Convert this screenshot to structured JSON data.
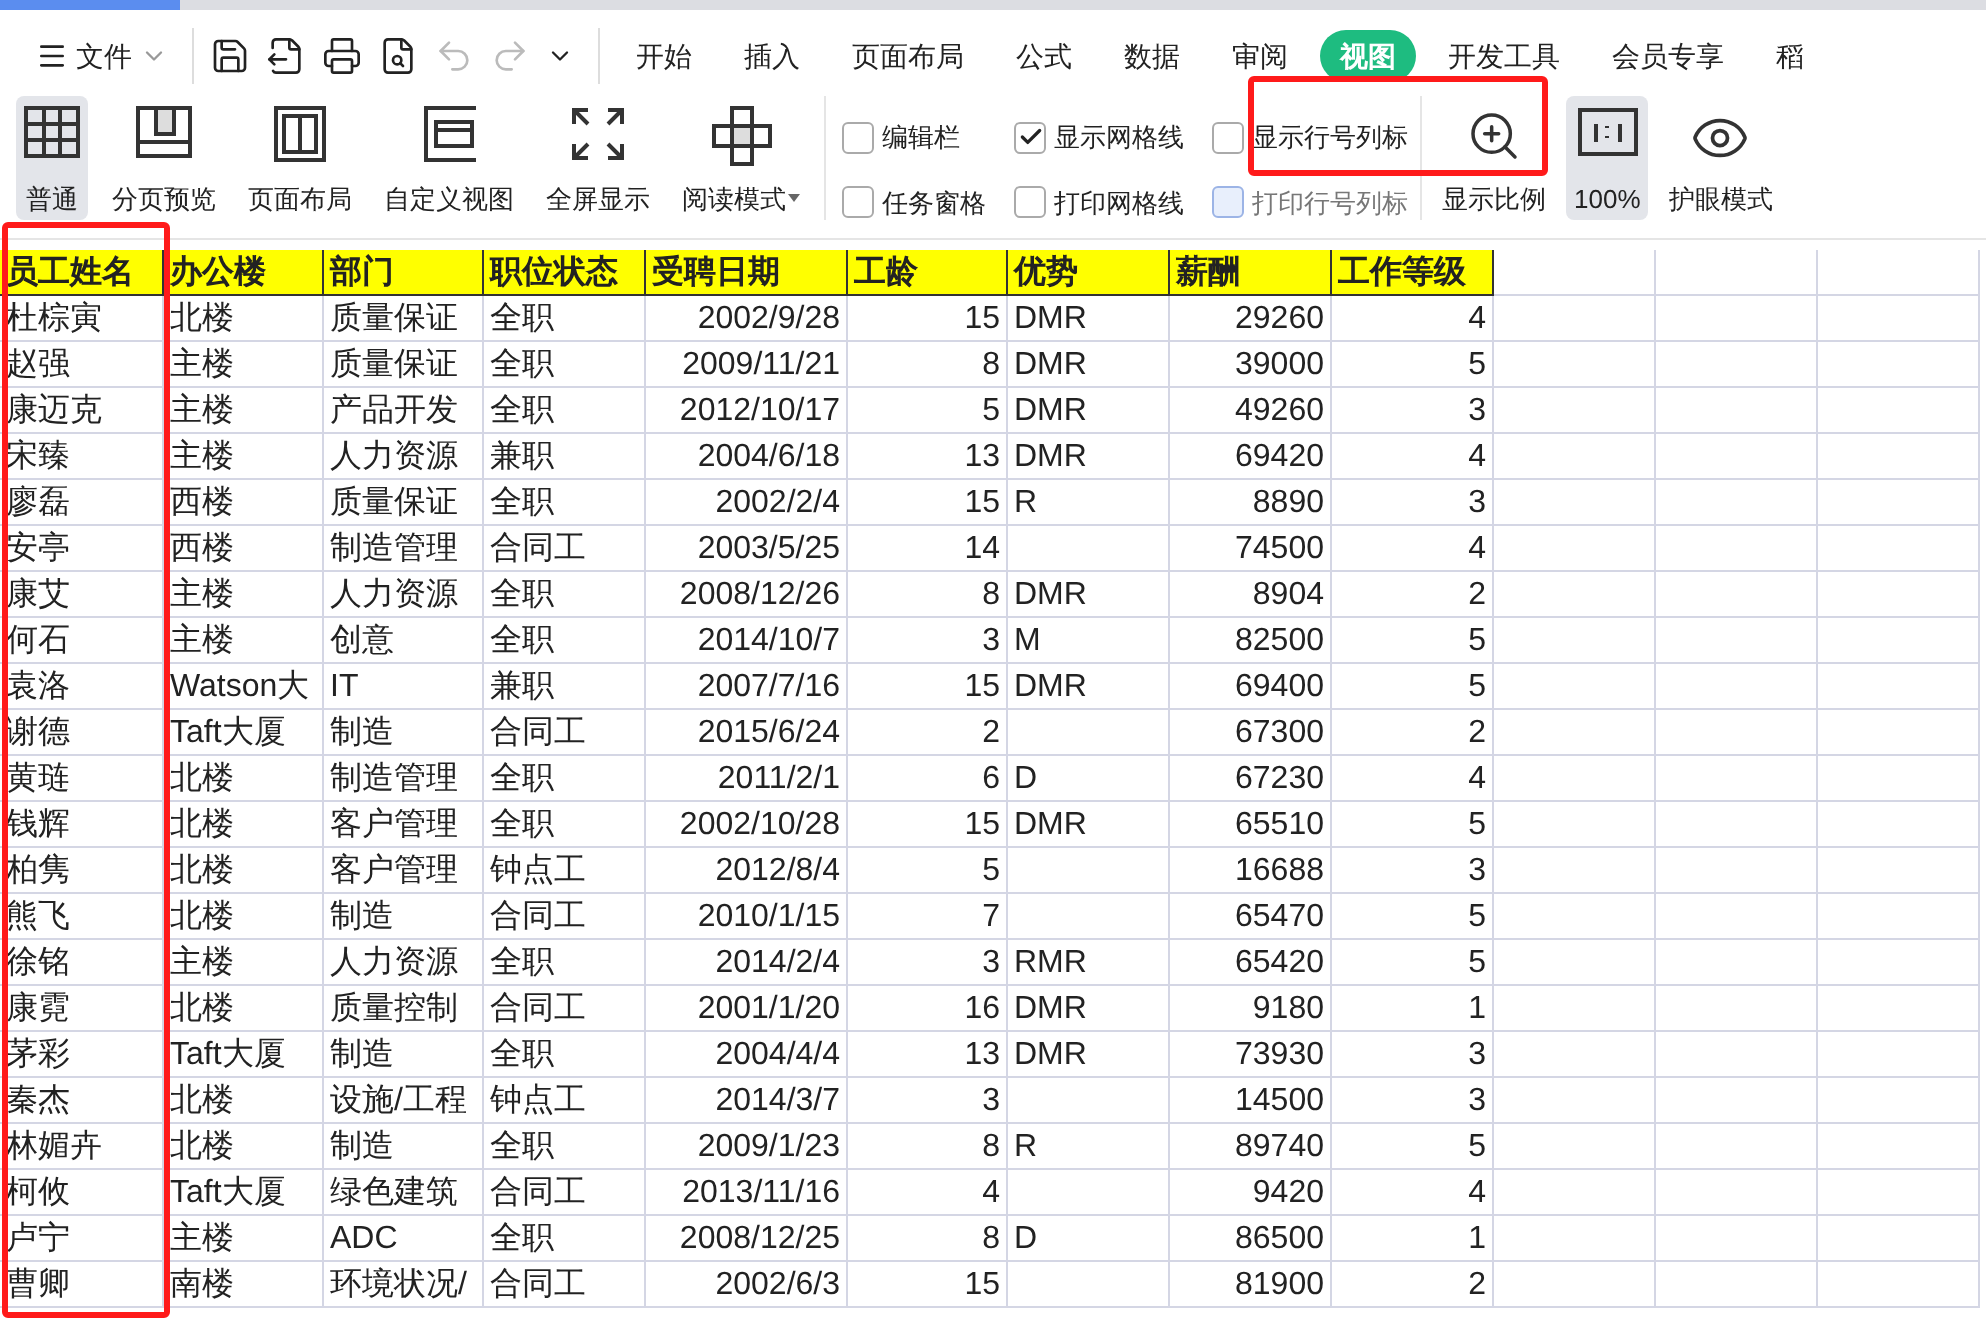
{
  "file_menu": {
    "label": "文件"
  },
  "menu_tabs": [
    {
      "label": "开始",
      "selected": false
    },
    {
      "label": "插入",
      "selected": false
    },
    {
      "label": "页面布局",
      "selected": false
    },
    {
      "label": "公式",
      "selected": false
    },
    {
      "label": "数据",
      "selected": false
    },
    {
      "label": "审阅",
      "selected": false
    },
    {
      "label": "视图",
      "selected": true
    },
    {
      "label": "开发工具",
      "selected": false
    },
    {
      "label": "会员专享",
      "selected": false
    },
    {
      "label": "稻",
      "selected": false
    }
  ],
  "view_buttons": [
    {
      "label": "普通",
      "kind": "normal",
      "selected": true
    },
    {
      "label": "分页预览",
      "kind": "pagebreak",
      "selected": false
    },
    {
      "label": "页面布局",
      "kind": "layout",
      "selected": false
    },
    {
      "label": "自定义视图",
      "kind": "custom",
      "selected": false
    },
    {
      "label": "全屏显示",
      "kind": "fullscreen",
      "selected": false
    },
    {
      "label": "阅读模式",
      "kind": "reading",
      "selected": false
    }
  ],
  "options": [
    {
      "label": "编辑栏",
      "checked": false,
      "disabled": false
    },
    {
      "label": "任务窗格",
      "checked": false,
      "disabled": false
    },
    {
      "label": "显示网格线",
      "checked": true,
      "disabled": false
    },
    {
      "label": "打印网格线",
      "checked": false,
      "disabled": false
    },
    {
      "label": "显示行号列标",
      "checked": false,
      "disabled": false
    },
    {
      "label": "打印行号列标",
      "checked": false,
      "disabled": true
    }
  ],
  "zoom_buttons": [
    {
      "label": "显示比例",
      "kind": "zoom",
      "selected": false
    },
    {
      "label": "100%",
      "kind": "actual",
      "selected": true
    },
    {
      "label": "护眼模式",
      "kind": "eye",
      "selected": false
    }
  ],
  "table": {
    "columns": [
      "员工姓名",
      "办公楼",
      "部门",
      "职位状态",
      "受聘日期",
      "工龄",
      "优势",
      "薪酬",
      "工作等级"
    ],
    "rows": [
      [
        "杜棕寅",
        "北楼",
        "质量保证",
        "全职",
        "2002/9/28",
        "15",
        "DMR",
        "29260",
        "4"
      ],
      [
        "赵强",
        "主楼",
        "质量保证",
        "全职",
        "2009/11/21",
        "8",
        "DMR",
        "39000",
        "5"
      ],
      [
        "康迈克",
        "主楼",
        "产品开发",
        "全职",
        "2012/10/17",
        "5",
        "DMR",
        "49260",
        "3"
      ],
      [
        "宋臻",
        "主楼",
        "人力资源",
        "兼职",
        "2004/6/18",
        "13",
        "DMR",
        "69420",
        "4"
      ],
      [
        "廖磊",
        "西楼",
        "质量保证",
        "全职",
        "2002/2/4",
        "15",
        "R",
        "8890",
        "3"
      ],
      [
        "安亭",
        "西楼",
        "制造管理",
        "合同工",
        "2003/5/25",
        "14",
        "",
        "74500",
        "4"
      ],
      [
        "康艾",
        "主楼",
        "人力资源",
        "全职",
        "2008/12/26",
        "8",
        "DMR",
        "8904",
        "2"
      ],
      [
        "何石",
        "主楼",
        "创意",
        "全职",
        "2014/10/7",
        "3",
        "M",
        "82500",
        "5"
      ],
      [
        "袁洛",
        "Watson大",
        "IT",
        "兼职",
        "2007/7/16",
        "15",
        "DMR",
        "69400",
        "5"
      ],
      [
        "谢德",
        "Taft大厦",
        "制造",
        "合同工",
        "2015/6/24",
        "2",
        "",
        "67300",
        "2"
      ],
      [
        "黄琏",
        "北楼",
        "制造管理",
        "全职",
        "2011/2/1",
        "6",
        "D",
        "67230",
        "4"
      ],
      [
        "钱辉",
        "北楼",
        "客户管理",
        "全职",
        "2002/10/28",
        "15",
        "DMR",
        "65510",
        "5"
      ],
      [
        "柏隽",
        "北楼",
        "客户管理",
        "钟点工",
        "2012/8/4",
        "5",
        "",
        "16688",
        "3"
      ],
      [
        "熊飞",
        "北楼",
        "制造",
        "合同工",
        "2010/1/15",
        "7",
        "",
        "65470",
        "5"
      ],
      [
        "徐铭",
        "主楼",
        "人力资源",
        "全职",
        "2014/2/4",
        "3",
        "RMR",
        "65420",
        "5"
      ],
      [
        "康霓",
        "北楼",
        "质量控制",
        "合同工",
        "2001/1/20",
        "16",
        "DMR",
        "9180",
        "1"
      ],
      [
        "茅彩",
        "Taft大厦",
        "制造",
        "全职",
        "2004/4/4",
        "13",
        "DMR",
        "73930",
        "3"
      ],
      [
        "秦杰",
        "北楼",
        "设施/工程",
        "钟点工",
        "2014/3/7",
        "3",
        "",
        "14500",
        "3"
      ],
      [
        "林媚卉",
        "北楼",
        "制造",
        "全职",
        "2009/1/23",
        "8",
        "R",
        "89740",
        "5"
      ],
      [
        "柯攸",
        "Taft大厦",
        "绿色建筑",
        "合同工",
        "2013/11/16",
        "4",
        "",
        "9420",
        "4"
      ],
      [
        "卢宁",
        "主楼",
        "ADC",
        "全职",
        "2008/12/25",
        "8",
        "D",
        "86500",
        "1"
      ],
      [
        "曹卿",
        "南楼",
        "环境状况/",
        "合同工",
        "2002/6/3",
        "15",
        "",
        "81900",
        "2"
      ]
    ]
  }
}
